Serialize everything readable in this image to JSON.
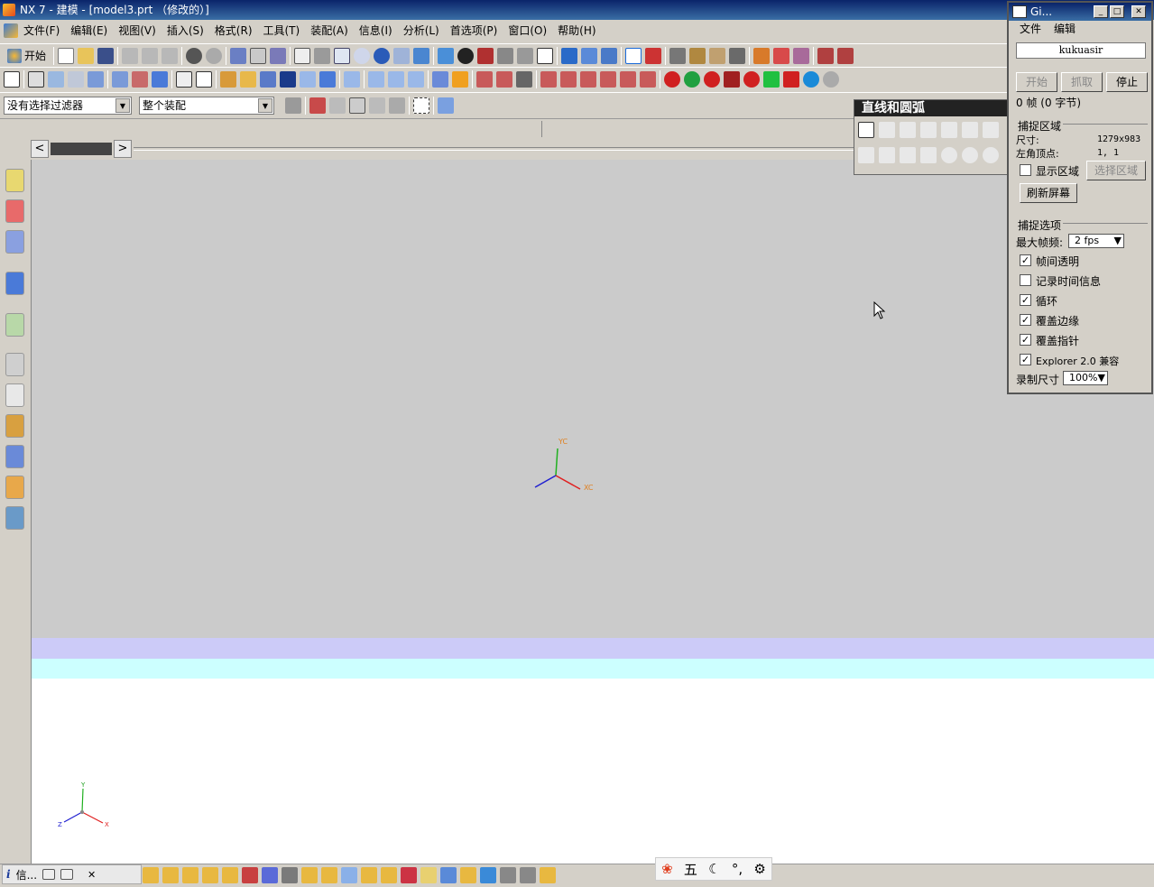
{
  "window": {
    "title": "NX 7 - 建模 - [model3.prt （修改的）]"
  },
  "menu": [
    "文件(F)",
    "编辑(E)",
    "视图(V)",
    "插入(S)",
    "格式(R)",
    "工具(T)",
    "装配(A)",
    "信息(I)",
    "分析(L)",
    "首选项(P)",
    "窗口(O)",
    "帮助(H)"
  ],
  "toolbar": {
    "start_label": "开始"
  },
  "filters": {
    "selection_filter": "没有选择过滤器",
    "scope": "整个装配"
  },
  "palette": {
    "title": "直线和圆弧"
  },
  "viewport": {
    "wcs": {
      "x": "XC",
      "y": "YC"
    },
    "abs": {
      "x": "X",
      "y": "Y",
      "z": "Z"
    }
  },
  "statusbar": {
    "info_tab": "信..."
  },
  "ime": {
    "mode": "五"
  },
  "gif_recorder": {
    "title": "Gi...",
    "menu": [
      "文件",
      "编辑"
    ],
    "filename": "kukuasir",
    "buttons": {
      "start": "开始",
      "capture": "抓取",
      "stop": "停止"
    },
    "frame_info": "0 帧 (0 字节)",
    "capture_area": {
      "section": "捕捉区域",
      "size_label": "尺寸:",
      "size_value": "1279x983",
      "origin_label": "左角顶点:",
      "origin_value": "1, 1",
      "show_area": "显示区域",
      "select_area": "选择区域",
      "refresh": "刷新屏幕"
    },
    "capture_options": {
      "section": "捕捉选项",
      "max_fps_label": "最大帧频:",
      "max_fps": "2 fps",
      "frame_transparent": "帧间透明",
      "log_time": "记录时间信息",
      "loop": "循环",
      "cover_edges": "覆盖边缘",
      "cover_pointer": "覆盖指针",
      "explorer_compat": "Explorer 2.0 兼容",
      "record_size_label": "录制尺寸",
      "record_size": "100%"
    },
    "checks": {
      "show_area": false,
      "frame_transparent": true,
      "log_time": false,
      "loop": true,
      "cover_edges": true,
      "cover_pointer": true,
      "explorer_compat": true
    }
  }
}
